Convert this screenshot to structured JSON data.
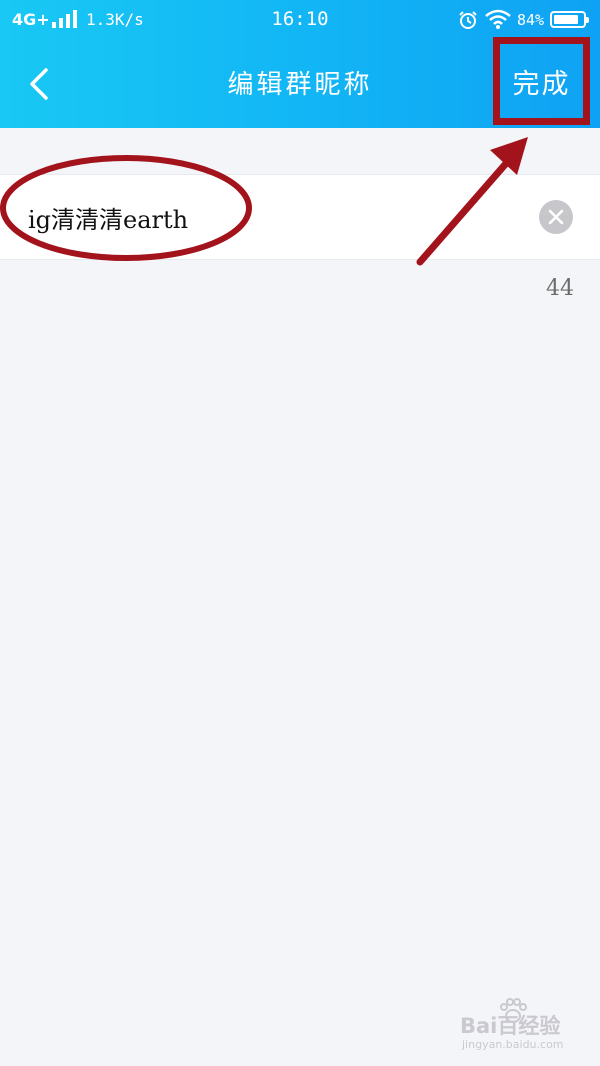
{
  "status_bar": {
    "network": "4G+",
    "speed": "1.3K/s",
    "time": "16:10",
    "battery_percent": "84%",
    "battery_level": 0.84
  },
  "header": {
    "title": "编辑群昵称",
    "done_label": "完成"
  },
  "nickname_input": {
    "value": "ig清清清earth"
  },
  "char_count": "44",
  "watermark": {
    "brand": "Bai百经验",
    "url": "jingyan.baidu.com"
  },
  "colors": {
    "header_gradient_start": "#19c8f4",
    "header_gradient_end": "#0fa2f4",
    "annotation_red": "#a3131b",
    "background": "#f4f5f9"
  }
}
